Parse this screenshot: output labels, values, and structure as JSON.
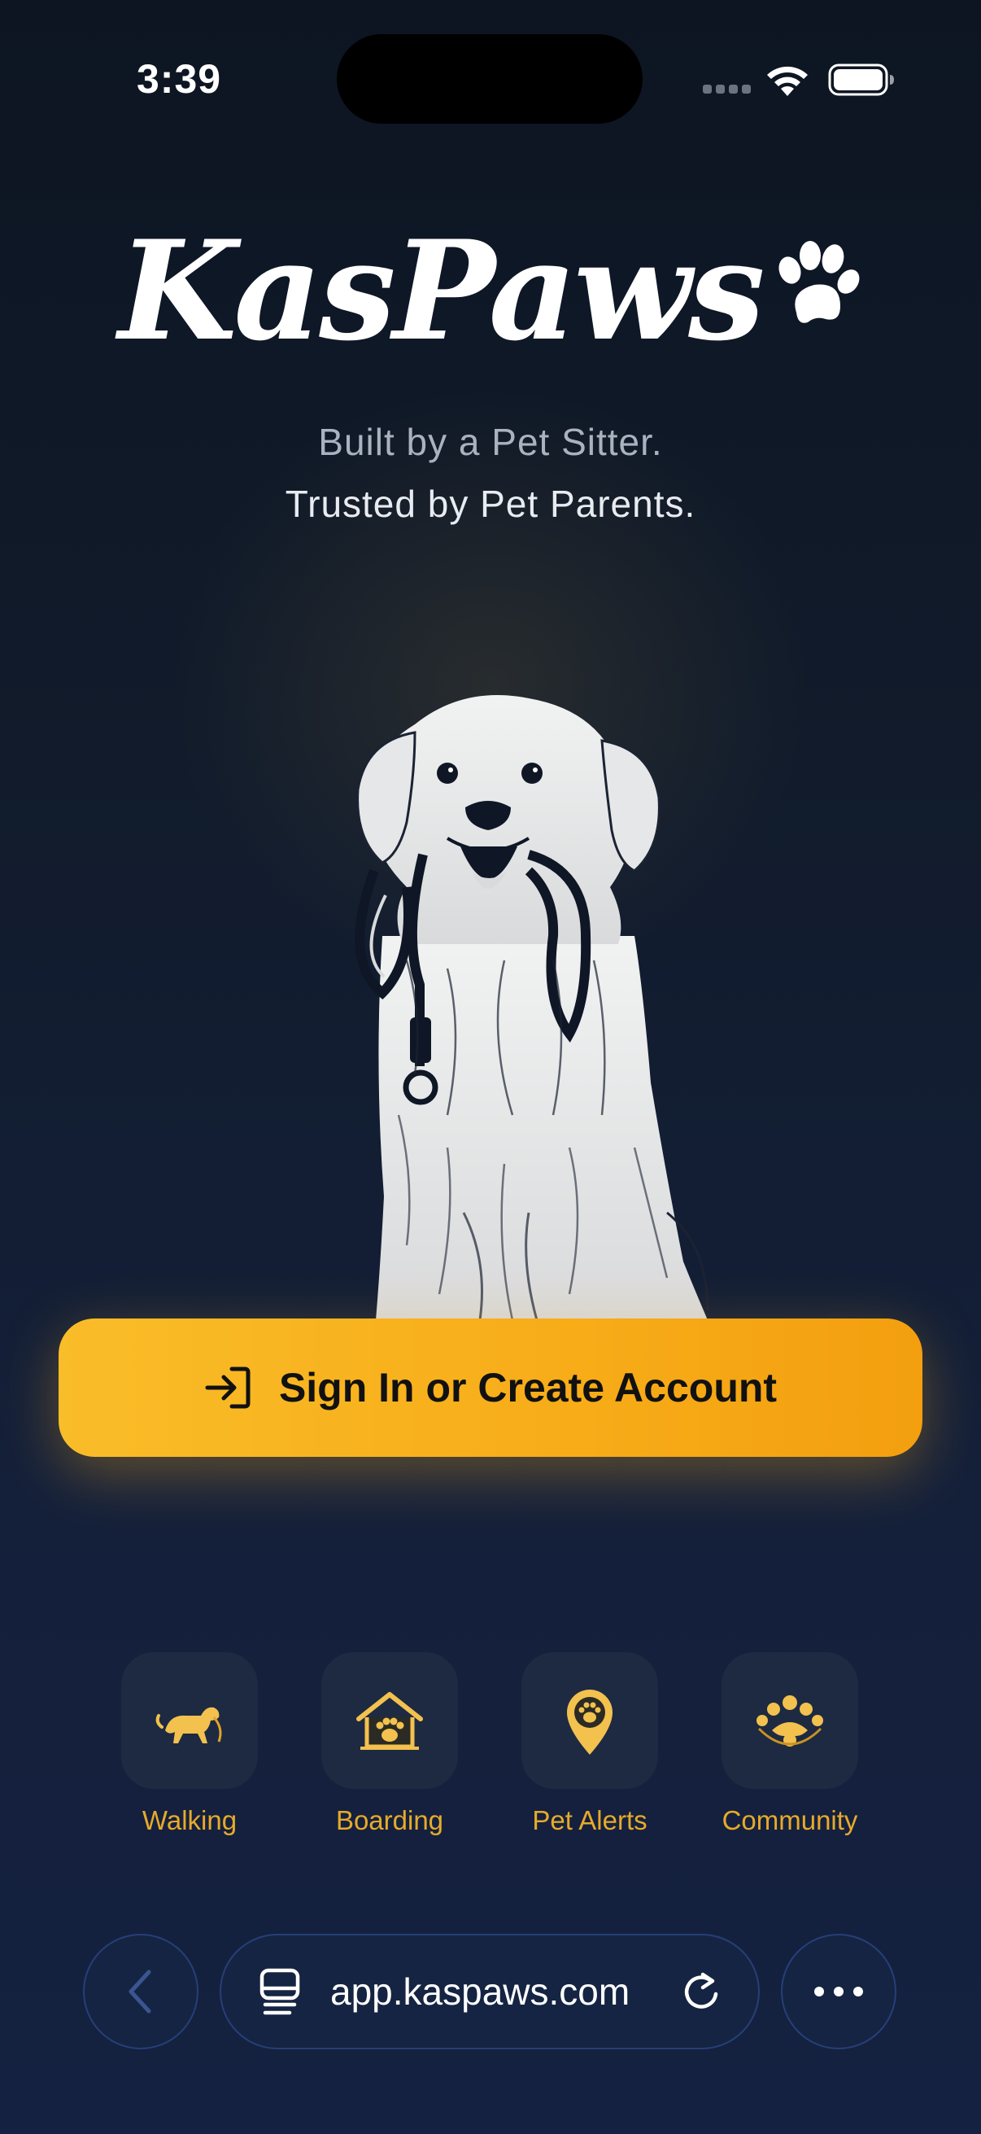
{
  "status_bar": {
    "time": "3:39",
    "icons": [
      "signal-icon",
      "wifi-icon",
      "battery-icon"
    ]
  },
  "brand": {
    "name": "KasPaws",
    "logo_icon": "paw-icon",
    "tagline_line1": "Built by a Pet Sitter.",
    "tagline_line2": "Trusted by Pet Parents."
  },
  "hero": {
    "image": "dog-with-leash-illustration"
  },
  "cta": {
    "label": "Sign In or Create Account",
    "icon": "sign-in-icon"
  },
  "features": [
    {
      "label": "Walking",
      "icon": "walking-dog-icon"
    },
    {
      "label": "Boarding",
      "icon": "house-paw-icon"
    },
    {
      "label": "Pet Alerts",
      "icon": "location-paw-icon"
    },
    {
      "label": "Community",
      "icon": "community-icon"
    }
  ],
  "browser": {
    "url": "app.kaspaws.com",
    "icons": [
      "back-chevron-icon",
      "tabs-icon",
      "reload-icon",
      "more-icon"
    ]
  },
  "colors": {
    "accent": "#F7AC18",
    "feature_label": "#E6AA2B",
    "background_top": "#0D1522",
    "background_bottom": "#142140"
  }
}
